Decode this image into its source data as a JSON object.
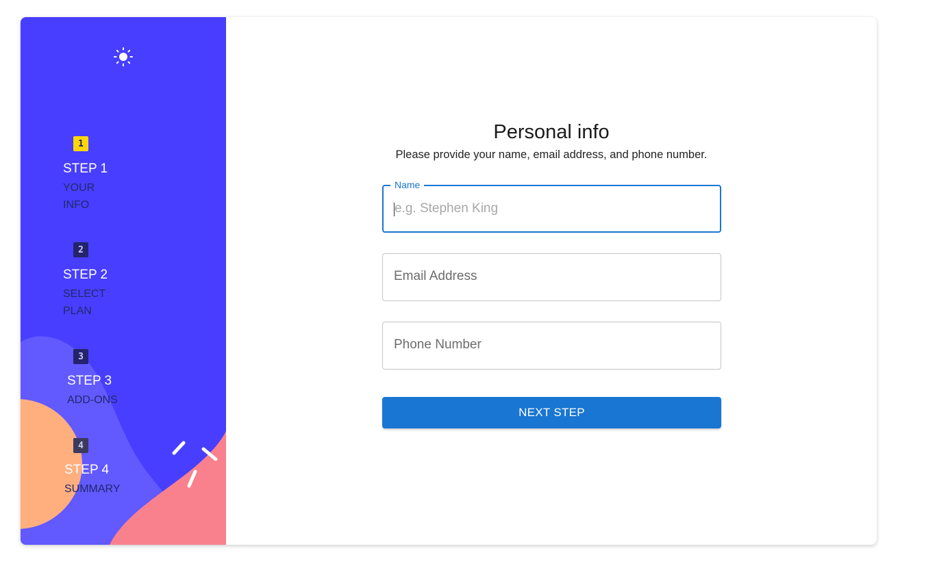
{
  "colors": {
    "sidebar_bg": "#483eff",
    "active_step": "#ffd60a",
    "primary": "#1976d2",
    "blob_orange": "#ffaf7e",
    "blob_pink": "#f9818e"
  },
  "sidebar": {
    "theme_toggle_icon": "sun-icon",
    "steps": [
      {
        "number": "1",
        "title": "STEP 1",
        "subtitle": "YOUR\nINFO",
        "active": true
      },
      {
        "number": "2",
        "title": "STEP 2",
        "subtitle": "SELECT\nPLAN",
        "active": false
      },
      {
        "number": "3",
        "title": "STEP 3",
        "subtitle": "ADD-ONS",
        "active": false
      },
      {
        "number": "4",
        "title": "STEP 4",
        "subtitle": "SUMMARY",
        "active": false
      }
    ]
  },
  "main": {
    "title": "Personal info",
    "subtitle": "Please provide your name, email address, and phone number.",
    "fields": {
      "name": {
        "label": "Name",
        "placeholder": "e.g. Stephen King",
        "value": ""
      },
      "email": {
        "label": "Email Address",
        "value": ""
      },
      "phone": {
        "label": "Phone Number",
        "value": ""
      }
    },
    "next_button": "NEXT STEP"
  }
}
